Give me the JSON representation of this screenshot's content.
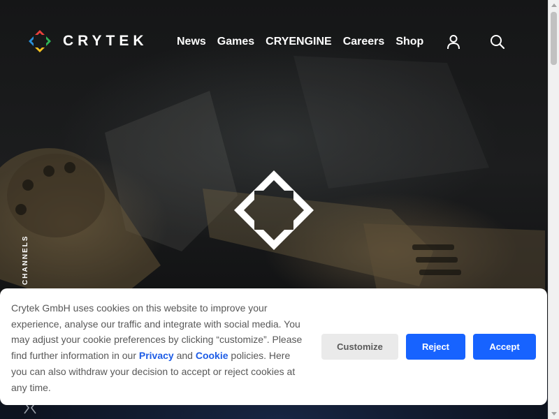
{
  "brand": {
    "name": "CRYTEK"
  },
  "nav": {
    "items": [
      {
        "label": "News"
      },
      {
        "label": "Games"
      },
      {
        "label": "CRYENGINE"
      },
      {
        "label": "Careers"
      },
      {
        "label": "Shop"
      }
    ]
  },
  "header_icons": [
    "user-icon",
    "search-icon"
  ],
  "side": {
    "channels_label": "CHANNELS"
  },
  "cookie": {
    "text_part1": "Crytek GmbH uses cookies on this website to improve your experience, analyse our traffic and integrate with social media. You may adjust your cookie preferences by clicking “customize”. Please find further information in our ",
    "privacy_link": "Privacy",
    "text_and": " and ",
    "cookie_link": "Cookie",
    "text_part2": " policies. Here you can also withdraw your decision to accept or reject cookies at any time.",
    "customize_label": "Customize",
    "reject_label": "Reject",
    "accept_label": "Accept"
  },
  "colors": {
    "accent_blue": "#1763ff",
    "link_blue": "#1d5ce6",
    "logo_red": "#e8413c",
    "logo_yellow": "#f5c020",
    "logo_green": "#2fb457",
    "logo_blue": "#2a8fd8"
  }
}
